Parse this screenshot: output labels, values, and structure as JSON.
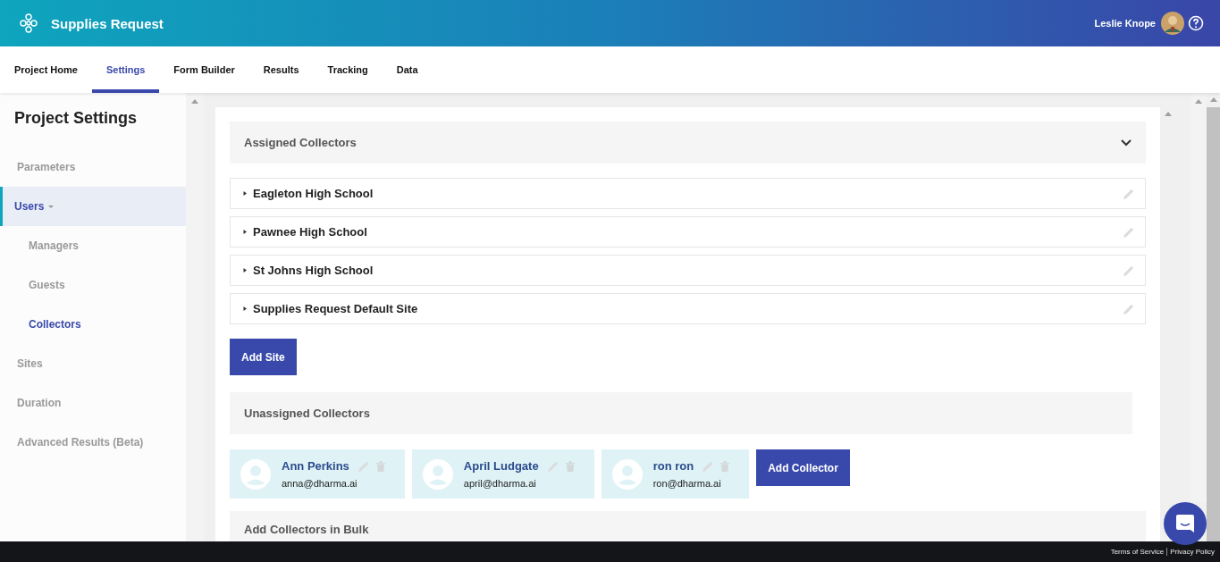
{
  "app": {
    "title": "Supplies Request",
    "user": "Leslie Knope"
  },
  "nav_tabs": [
    {
      "label": "Project Home",
      "selected": false
    },
    {
      "label": "Settings",
      "selected": true
    },
    {
      "label": "Form Builder",
      "selected": false
    },
    {
      "label": "Results",
      "selected": false
    },
    {
      "label": "Tracking",
      "selected": false
    },
    {
      "label": "Data",
      "selected": false
    }
  ],
  "sidebar": {
    "title": "Project Settings",
    "items": [
      {
        "label": "Parameters",
        "selected": false
      },
      {
        "label": "Users",
        "selected": true,
        "expanded": true,
        "children": [
          {
            "label": "Managers",
            "selected": false
          },
          {
            "label": "Guests",
            "selected": false
          },
          {
            "label": "Collectors",
            "selected": true
          }
        ]
      },
      {
        "label": "Sites",
        "selected": false
      },
      {
        "label": "Duration",
        "selected": false
      },
      {
        "label": "Advanced Results (Beta)",
        "selected": false
      }
    ]
  },
  "assigned_collectors": {
    "title": "Assigned Collectors",
    "expanded": true,
    "sites": [
      {
        "name": "Eagleton High School",
        "expanded": false
      },
      {
        "name": "Pawnee High School",
        "expanded": false
      },
      {
        "name": "St Johns High School",
        "expanded": false
      },
      {
        "name": "Supplies Request Default Site",
        "expanded": false
      }
    ],
    "add_button": "Add Site"
  },
  "unassigned_collectors": {
    "title": "Unassigned Collectors",
    "collectors": [
      {
        "name": "Ann Perkins",
        "email": "anna@dharma.ai"
      },
      {
        "name": "April Ludgate",
        "email": "april@dharma.ai"
      },
      {
        "name": "ron ron",
        "email": "ron@dharma.ai"
      }
    ],
    "add_button": "Add Collector"
  },
  "bulk_section": {
    "title": "Add Collectors in Bulk"
  },
  "footer": {
    "links": [
      "Terms of Service",
      "Privacy Policy"
    ]
  }
}
